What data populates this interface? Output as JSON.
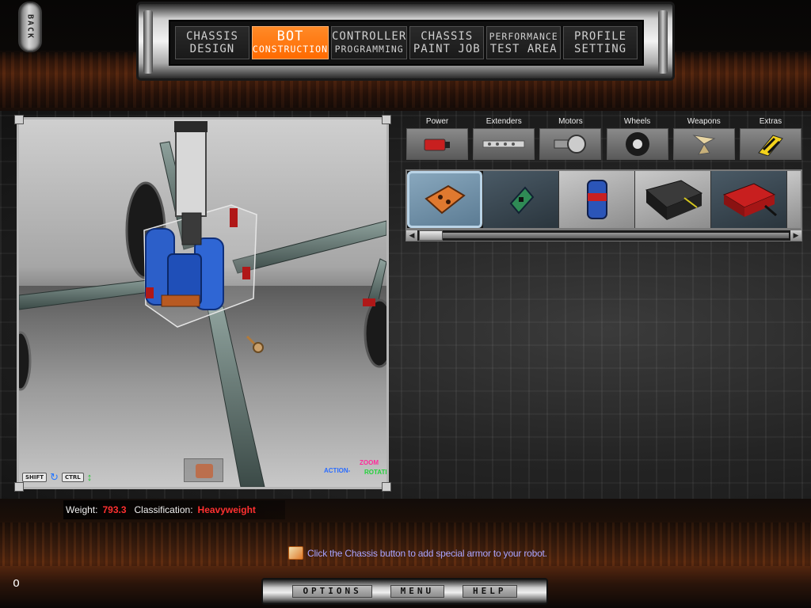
{
  "back_label": "BACK",
  "nav": {
    "tabs": [
      {
        "line1": "CHASSIS",
        "line2": "DESIGN",
        "active": false
      },
      {
        "line1": "BOT",
        "line2": "CONSTRUCTION",
        "active": true
      },
      {
        "line1": "CONTROLLER",
        "line2": "PROGRAMMING",
        "active": false
      },
      {
        "line1": "CHASSIS",
        "line2": "PAINT JOB",
        "active": false
      },
      {
        "line1": "PERFORMANCE",
        "line2": "TEST AREA",
        "active": false
      },
      {
        "line1": "PROFILE",
        "line2": "SETTING",
        "active": false
      }
    ]
  },
  "viewport": {
    "shift_key": "SHIFT",
    "ctrl_key": "CTRL",
    "action_label": "ACTION-",
    "zoom_label": "ZOOM",
    "rotate_label": "ROTATE"
  },
  "parts": {
    "categories": [
      {
        "label": "Power",
        "icon": "battery-icon"
      },
      {
        "label": "Extenders",
        "icon": "extender-bar-icon"
      },
      {
        "label": "Motors",
        "icon": "motor-icon"
      },
      {
        "label": "Wheels",
        "icon": "wheel-icon"
      },
      {
        "label": "Weapons",
        "icon": "blade-icon"
      },
      {
        "label": "Extras",
        "icon": "hazard-icon"
      }
    ],
    "items": [
      "orange-circuit-board-icon",
      "green-circuit-board-icon",
      "blue-canister-icon",
      "black-battery-pack-icon",
      "red-battery-icon"
    ],
    "selected_index": 0
  },
  "stats": {
    "weight_label": "Weight:",
    "weight_value": "793.3",
    "class_label": "Classification:",
    "class_value": "Heavyweight"
  },
  "tip": {
    "text": "Click the Chassis button to add special armor to your robot."
  },
  "menu": {
    "options": "OPTIONS",
    "menu": "MENU",
    "help": "HELP"
  },
  "colors": {
    "accent": "#ff6a00",
    "value_red": "#ff3030",
    "tip_text": "#a9a4ff"
  }
}
